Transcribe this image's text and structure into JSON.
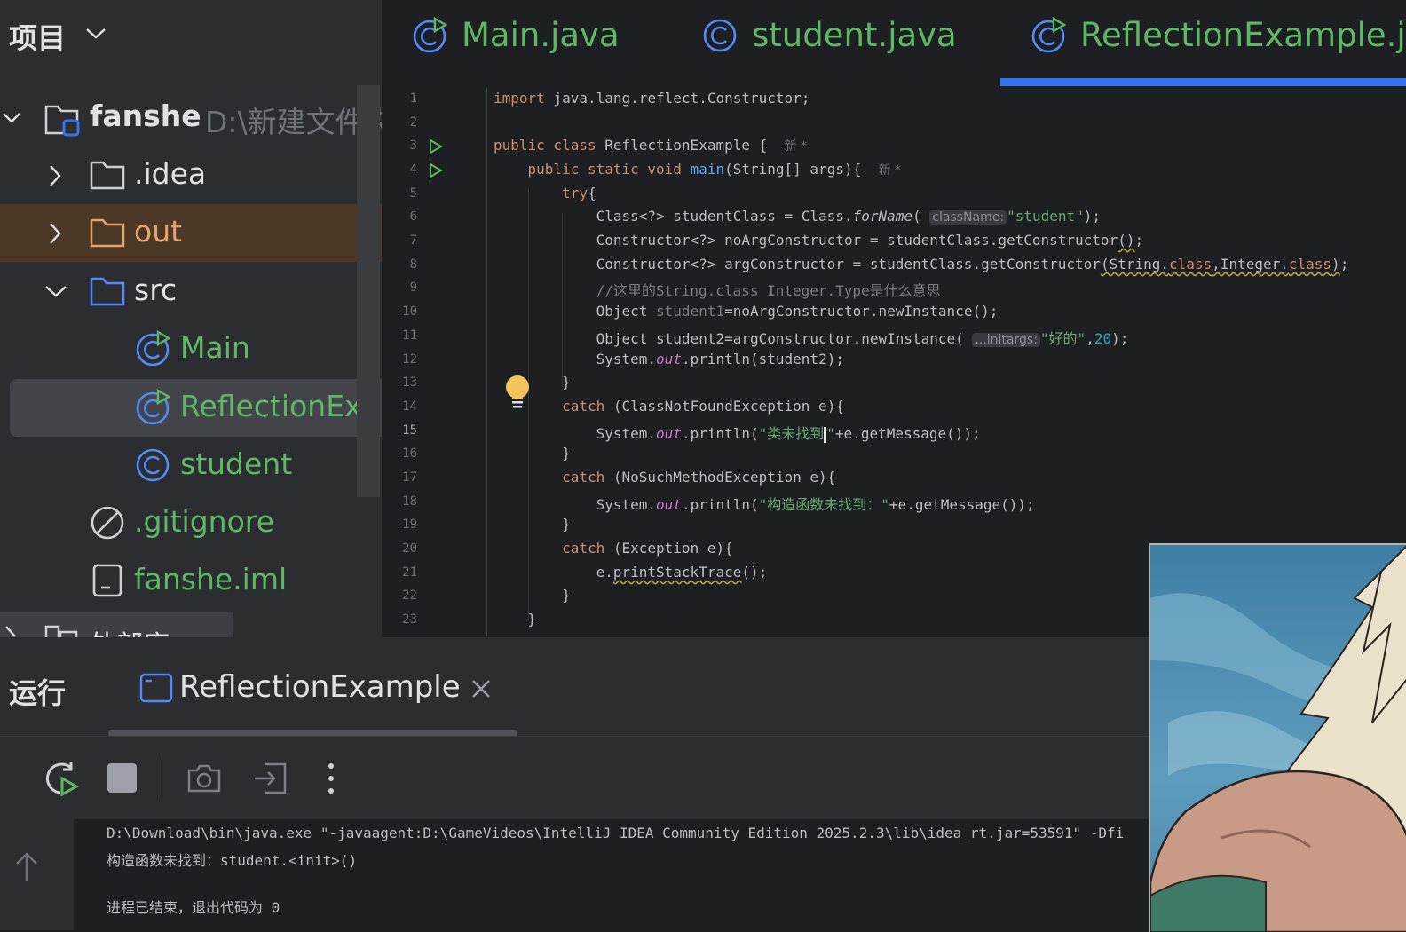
{
  "project_panel": {
    "title": "项目",
    "tree": [
      {
        "label": "fanshe",
        "hint": "D:\\新建文件夹",
        "type": "project"
      },
      {
        "label": ".idea",
        "type": "folder"
      },
      {
        "label": "out",
        "type": "folder-excluded"
      },
      {
        "label": "src",
        "type": "folder-source"
      },
      {
        "label": "Main",
        "type": "java-runnable"
      },
      {
        "label": "ReflectionExample",
        "type": "java-runnable",
        "selected": true
      },
      {
        "label": "student",
        "type": "java-class"
      },
      {
        "label": ".gitignore",
        "type": "ignore-file"
      },
      {
        "label": "fanshe.iml",
        "type": "iml-file"
      },
      {
        "label": "外部库",
        "type": "external-libs"
      }
    ]
  },
  "editor_tabs": [
    {
      "label": "Main.java",
      "icon": "java-runnable-icon"
    },
    {
      "label": "student.java",
      "icon": "java-class-icon"
    },
    {
      "label": "ReflectionExample.java",
      "icon": "java-runnable-icon",
      "active": true
    }
  ],
  "code": {
    "current_line": 15,
    "line_numbers": [
      "1",
      "2",
      "3",
      "4",
      "5",
      "6",
      "7",
      "8",
      "9",
      "10",
      "11",
      "12",
      "13",
      "14",
      "15",
      "16",
      "17",
      "18",
      "19",
      "20",
      "21",
      "22",
      "23"
    ],
    "new_tag": "新 *",
    "hint_class_name": "className:",
    "hint_initargs": "...initargs:",
    "comment_line9": "//这里的String.class Integer.Type是什么意思",
    "str_student": "\"student\"",
    "str_haode": "\"好的\"",
    "num_20": "20",
    "str_class_not_found_a": "\"类未找到",
    "str_class_not_found_b": "\"",
    "str_ctor_not_found": "\"构造函数未找到：\""
  },
  "run_window": {
    "title": "运行",
    "tab_label": "ReflectionExample",
    "console": [
      "D:\\Download\\bin\\java.exe \"-javaagent:D:\\GameVideos\\IntelliJ IDEA Community Edition 2025.2.3\\lib\\idea_rt.jar=53591\" -Dfi",
      "构造函数未找到：student.<init>()",
      "",
      "进程已结束，退出代码为 0"
    ]
  },
  "colors": {
    "accent": "#3574f0",
    "run_green": "#5fb865",
    "keyword": "#cf8e6d",
    "string": "#6aab73",
    "excluded_folder": "#e7a36b"
  }
}
